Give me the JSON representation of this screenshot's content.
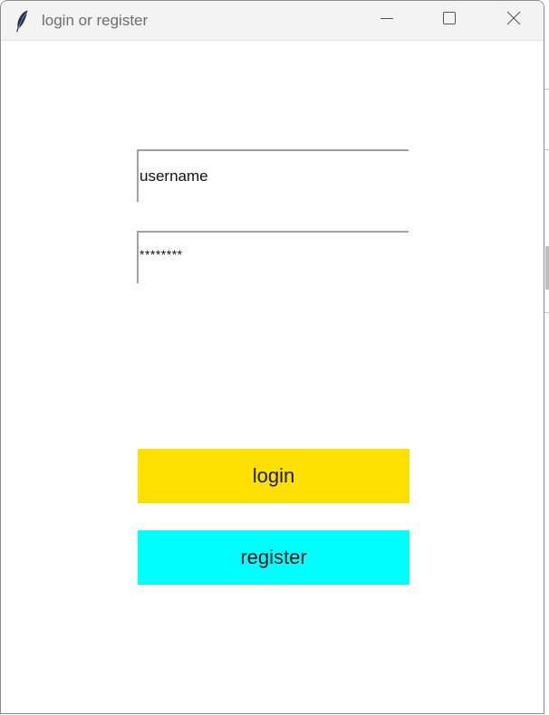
{
  "window": {
    "title": "login or register",
    "icon": "feather-icon",
    "controls": [
      "minimize-icon",
      "maximize-icon",
      "close-icon"
    ]
  },
  "form": {
    "username": {
      "value": "username"
    },
    "password": {
      "value": "********"
    },
    "login_button": {
      "label": "login",
      "color": "#ffdf00"
    },
    "register_button": {
      "label": "register",
      "color": "#00ffff"
    }
  }
}
